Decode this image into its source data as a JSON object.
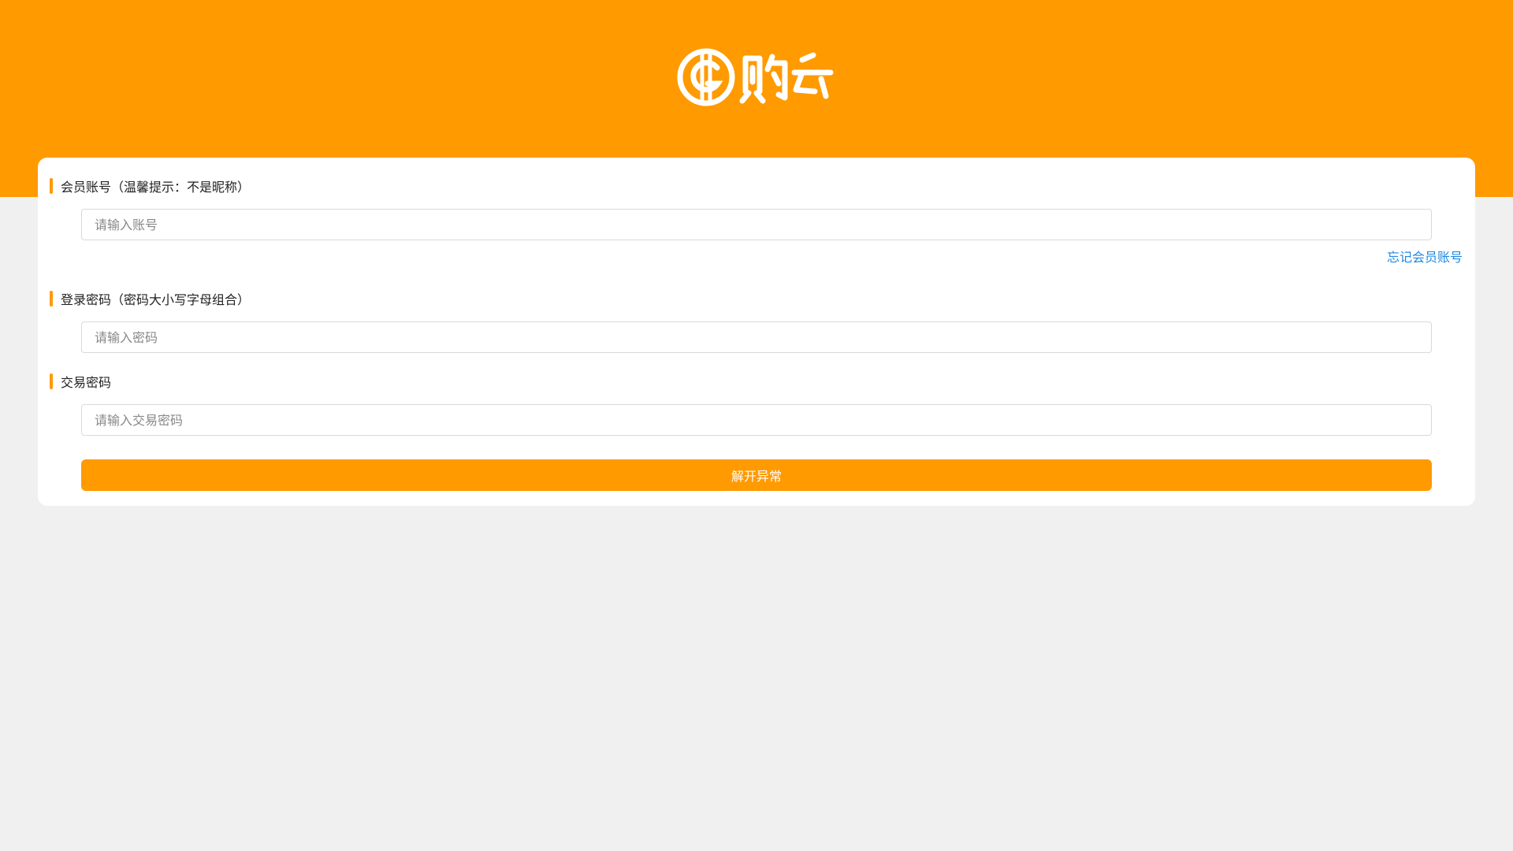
{
  "brand": {
    "logo_text": "购云",
    "header_color": "#ff9a00"
  },
  "form": {
    "account": {
      "label": "会员账号（温馨提示：不是昵称）",
      "placeholder": "请输入账号",
      "value": ""
    },
    "forgot_account_link": "忘记会员账号",
    "password": {
      "label": "登录密码（密码大小写字母组合）",
      "placeholder": "请输入密码",
      "value": ""
    },
    "trade_password": {
      "label": "交易密码",
      "placeholder": "请输入交易密码",
      "value": ""
    },
    "submit_label": "解开异常"
  },
  "colors": {
    "accent": "#ff9a00",
    "link": "#1e88e5",
    "background": "#f0f0f0"
  }
}
